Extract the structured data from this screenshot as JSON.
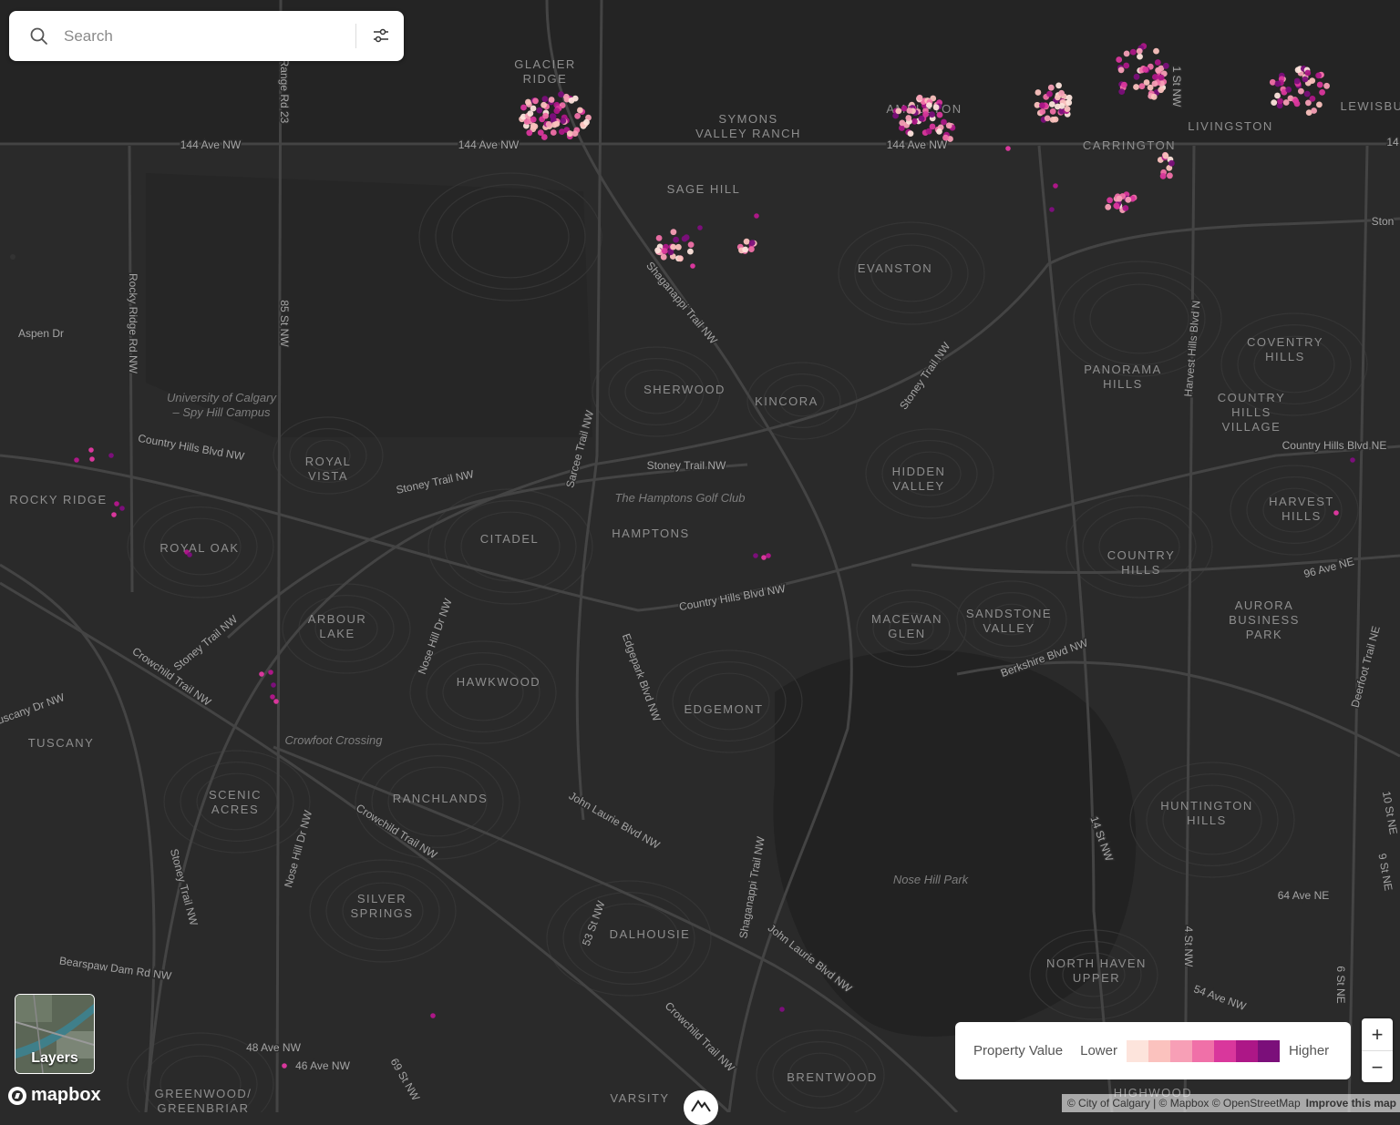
{
  "search": {
    "placeholder": "Search"
  },
  "layers_button": {
    "label": "Layers"
  },
  "mapbox_logo": {
    "text": "mapbox"
  },
  "legend": {
    "title": "Property Value",
    "lower": "Lower",
    "higher": "Higher",
    "colors": [
      "#fde4dc",
      "#fbc2be",
      "#f79fb6",
      "#f070a8",
      "#d9379c",
      "#ad1787",
      "#7b0f7a"
    ]
  },
  "zoom": {
    "in": "+",
    "out": "−"
  },
  "attribution": {
    "city": "© City of Calgary",
    "mapbox": "© Mapbox",
    "osm": "© OpenStreetMap",
    "improve": "Improve this map"
  },
  "map": {
    "neighbourhoods": [
      "GLACIER RIDGE",
      "SYMONS VALLEY RANCH",
      "AMBLETON",
      "CARRINGTON",
      "LIVINGSTON",
      "LEWISBU",
      "SAGE HILL",
      "EVANSTON",
      "COVENTRY HILLS",
      "PANORAMA HILLS",
      "COUNTRY HILLS VILLAGE",
      "SHERWOOD",
      "KINCORA",
      "HIDDEN VALLEY",
      "HARVEST HILLS",
      "ROYAL VISTA",
      "ROCKY RIDGE",
      "ROYAL OAK",
      "CITADEL",
      "HAMPTONS",
      "COUNTRY HILLS",
      "AURORA BUSINESS PARK",
      "ARBOUR LAKE",
      "MACEWAN GLEN",
      "SANDSTONE VALLEY",
      "HAWKWOOD",
      "EDGEMONT",
      "TUSCANY",
      "SCENIC ACRES",
      "RANCHLANDS",
      "HUNTINGTON HILLS",
      "SILVER SPRINGS",
      "DALHOUSIE",
      "NORTH HAVEN UPPER",
      "GREENWOOD/ GREENBRIAR",
      "VARSITY",
      "BRENTWOOD",
      "HIGHWOOD"
    ],
    "roads": [
      "144 Ave NW",
      "Range Rd 23",
      "Rocky Ridge Rd NW",
      "85 St NW",
      "Aspen Dr",
      "Shaganappi Trail NW",
      "Stoney Trail NW",
      "Harvest Hills Blvd N",
      "Country Hills Blvd NW",
      "Country Hills Blvd NE",
      "Sarcee Trail NW",
      "96 Ave NE",
      "Nose Hill Dr NW",
      "Edgepark Blvd NW",
      "Berkshire Blvd NW",
      "Deerfoot Trail NE",
      "Crowchild Trail NW",
      "Tuscany Dr NW",
      "John Laurie Blvd NW",
      "14 St NW",
      "10 St NE",
      "9 St NE",
      "64 Ave NE",
      "53 St NW",
      "54 Ave NW",
      "6 St NE",
      "4 St NW",
      "Bearspaw Dam Rd NW",
      "48 Ave NW",
      "46 Ave NW",
      "69 St NW",
      "Ston",
      "14",
      "1 St NW"
    ],
    "places": [
      "University of Calgary – Spy Hill Campus",
      "The Hamptons Golf Club",
      "Crowfoot Crossing",
      "Nose Hill Park"
    ]
  }
}
